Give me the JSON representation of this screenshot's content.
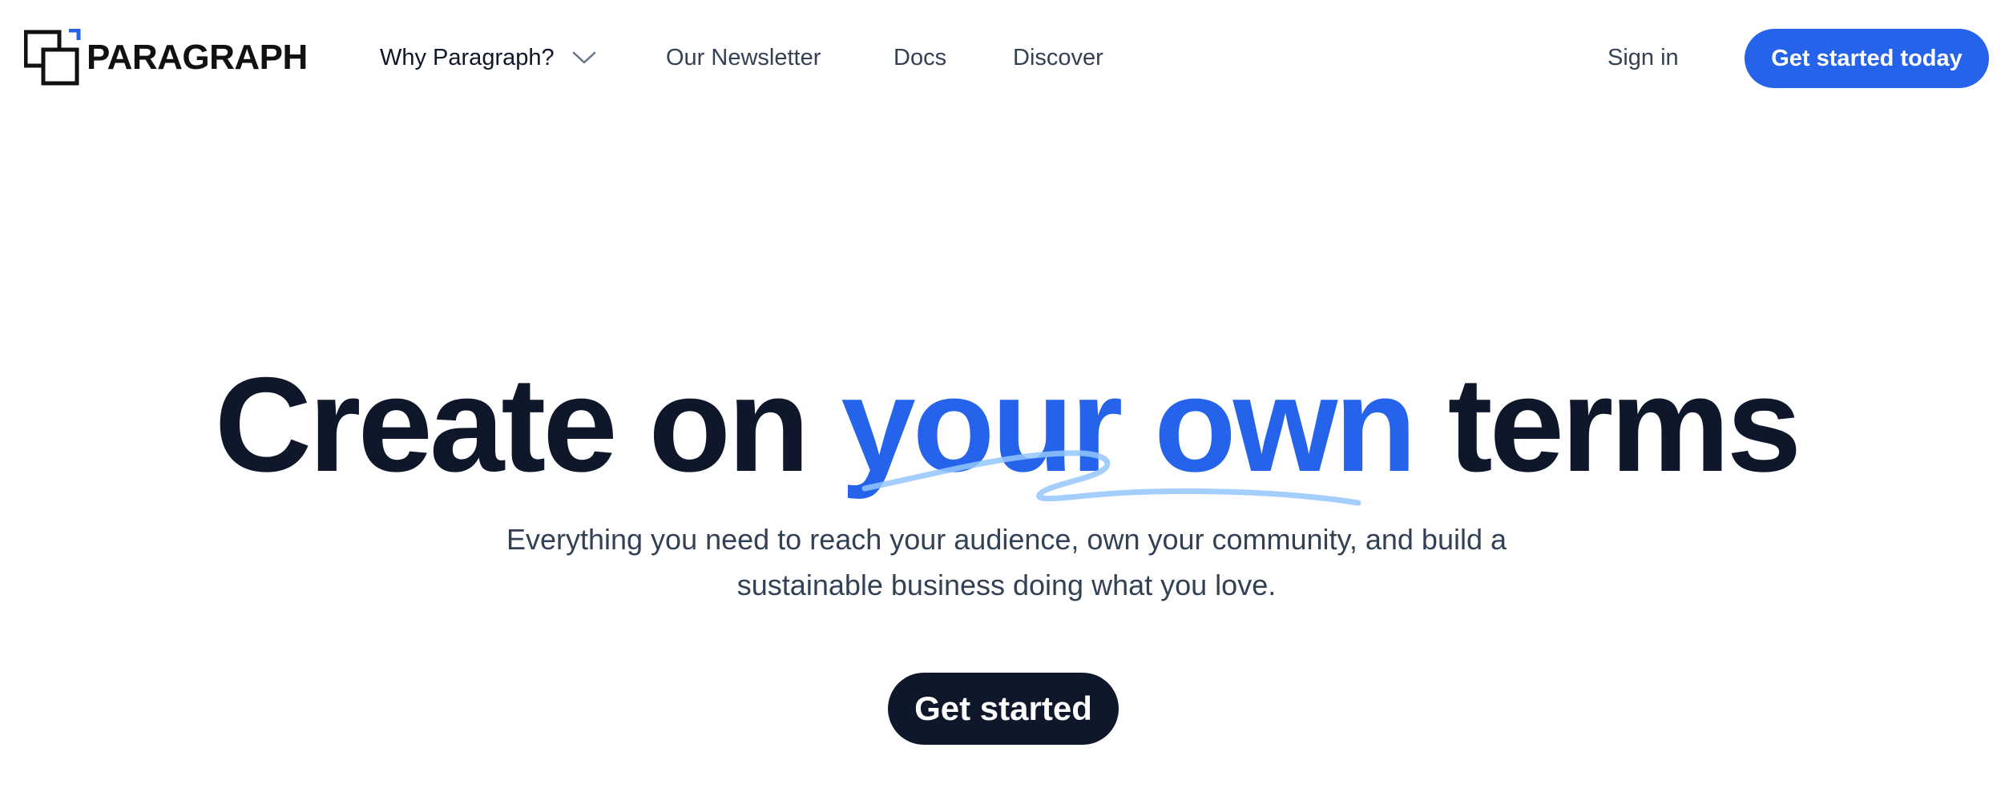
{
  "brand": {
    "name": "PARAGRAPH",
    "accent_color": "#2563eb",
    "dark_color": "#0f172a"
  },
  "nav": {
    "why_label": "Why Paragraph?",
    "newsletter_label": "Our Newsletter",
    "docs_label": "Docs",
    "discover_label": "Discover",
    "signin_label": "Sign in",
    "cta_label": "Get started today",
    "why_icon": "chevron-down-icon"
  },
  "hero": {
    "title_prefix": "Create on ",
    "title_accent": "your own",
    "title_suffix": " terms",
    "subtitle_line1": "Everything you need to reach your audience, own your community, and build a",
    "subtitle_line2": "sustainable business doing what you love.",
    "cta_label": "Get started"
  }
}
